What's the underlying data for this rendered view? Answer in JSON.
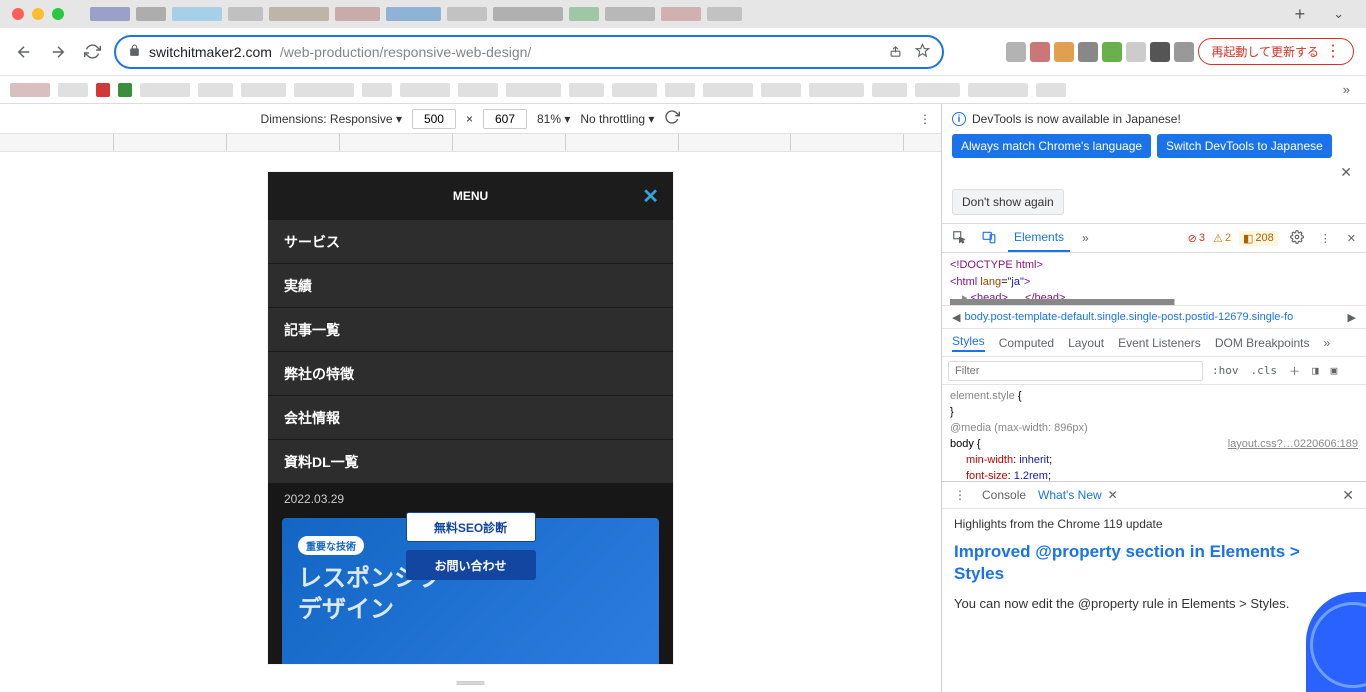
{
  "browser": {
    "url_host": "switchitmaker2.com",
    "url_path": "/web-production/responsive-web-design/",
    "update_label": "再起動して更新する",
    "new_tab_plus": "+"
  },
  "device_toolbar": {
    "dimensions_label": "Dimensions: Responsive",
    "width": "500",
    "x": "×",
    "height": "607",
    "zoom": "81%",
    "throttling": "No throttling"
  },
  "mobile_page": {
    "menu_title": "MENU",
    "menu_items": [
      "サービス",
      "実績",
      "記事一覧",
      "弊社の特徴",
      "会社情報",
      "資料DL一覧"
    ],
    "date": "2022.03.29",
    "hero_badge": "重要な技術",
    "hero_title_1": "レスポンシブ",
    "hero_title_2": "デザイン",
    "cta_seo": "無料SEO診断",
    "cta_contact": "お問い合わせ"
  },
  "devtools": {
    "notice": "DevTools is now available in Japanese!",
    "btn_always": "Always match Chrome's language",
    "btn_switch": "Switch DevTools to Japanese",
    "btn_dont": "Don't show again",
    "tab_elements": "Elements",
    "errors": "3",
    "warnings": "2",
    "issues": "208",
    "src_doctype": "<!DOCTYPE html>",
    "src_html_open": "<html ",
    "src_lang_attr": "lang",
    "src_lang_val": "\"ja\"",
    "src_html_close": ">",
    "src_head": "<head>",
    "src_head_dots": "…",
    "src_head_end": "</head>",
    "crumb": "body.post-template-default.single.single-post.postid-12679.single-fo",
    "subtabs": [
      "Styles",
      "Computed",
      "Layout",
      "Event Listeners",
      "DOM Breakpoints"
    ],
    "filter_placeholder": "Filter",
    "hov": ":hov",
    "cls": ".cls",
    "styles_element": "element.style",
    "brace_open": " {",
    "brace_close": "}",
    "media": "@media (max-width: 896px)",
    "body_sel": "body",
    "css_link": "layout.css?…0220606:189",
    "prop_minwidth": "min-width",
    "val_minwidth": "inherit",
    "prop_fontsize": "font-size",
    "val_fontsize": "1.2rem",
    "drawer_tabs": {
      "console": "Console",
      "whatsnew": "What's New"
    },
    "drawer_highlights": "Highlights from the Chrome 119 update",
    "drawer_title": "Improved @property section in Elements > Styles",
    "drawer_p": "You can now edit the @property rule in Elements > Styles."
  }
}
